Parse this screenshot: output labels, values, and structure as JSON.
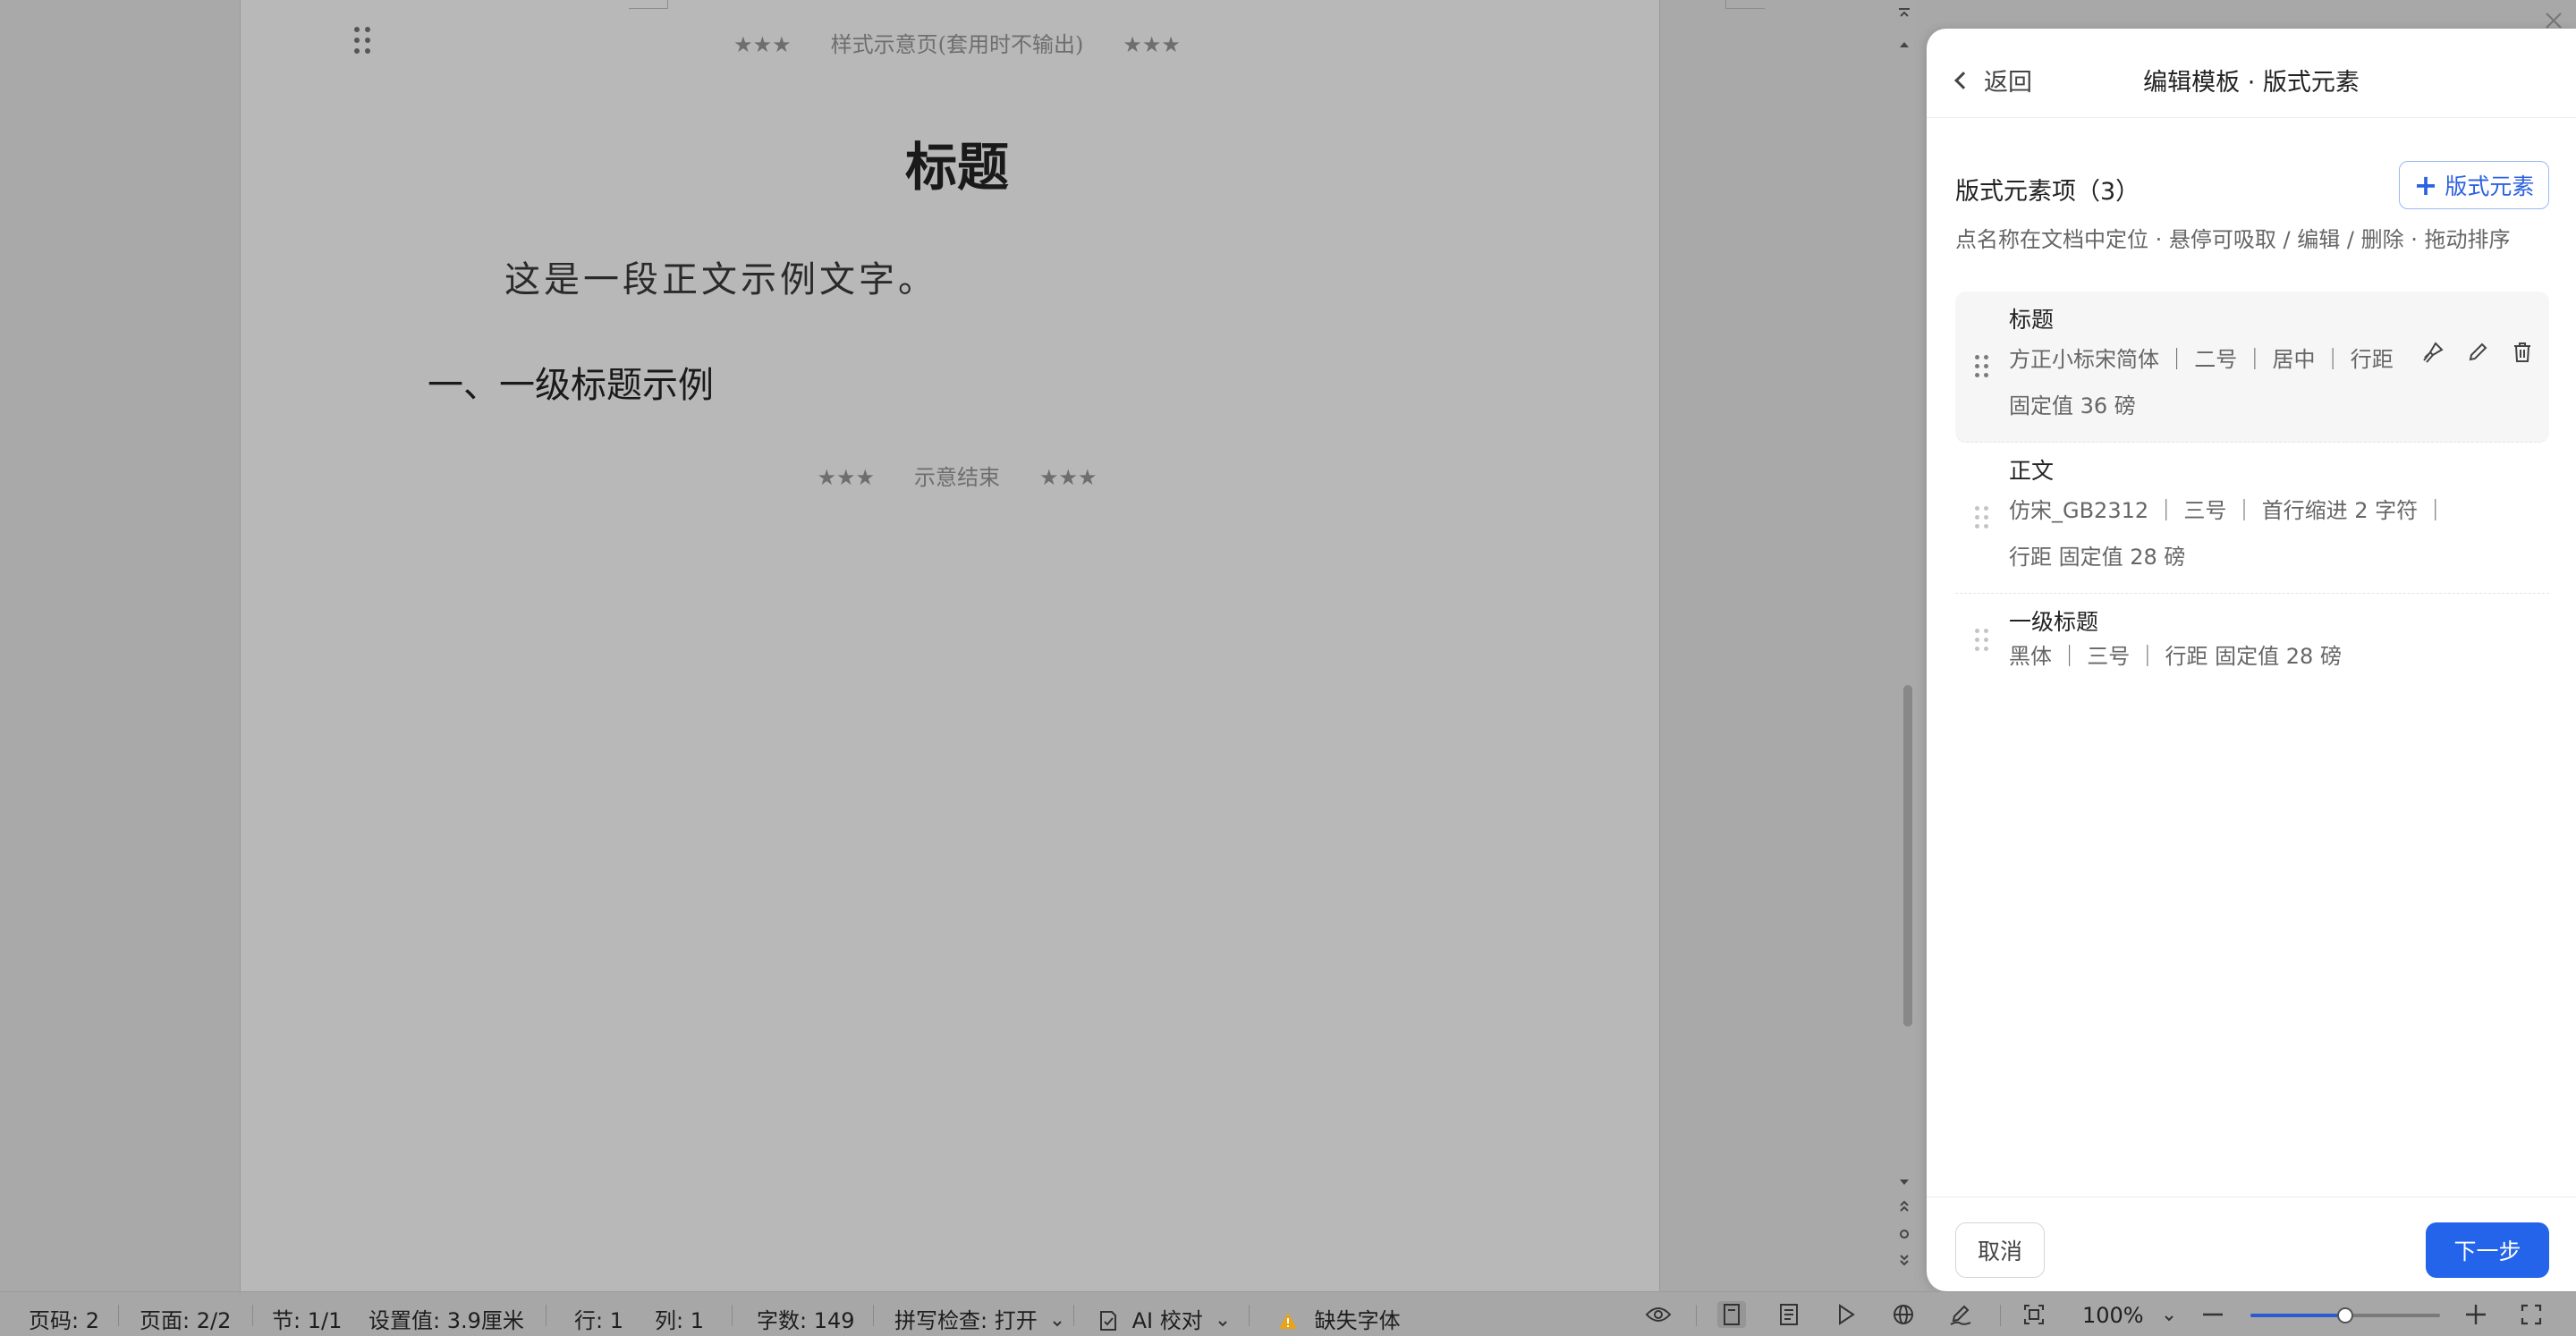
{
  "document": {
    "demo_header": {
      "stars_left": "★★★",
      "text": "样式示意页(套用时不输出)",
      "stars_right": "★★★"
    },
    "title": "标题",
    "body_text": "这是一段正文示例文字。",
    "heading1": "一、一级标题示例",
    "demo_footer": {
      "stars_left": "★★★",
      "text": "示意结束",
      "stars_right": "★★★"
    }
  },
  "panel": {
    "back_label": "返回",
    "title": "编辑模板 · 版式元素",
    "section_title": "版式元素项（3）",
    "add_label": "版式元素",
    "hint": "点名称在文档中定位 · 悬停可吸取 / 编辑 / 删除 · 拖动排序",
    "items": [
      {
        "name": "标题",
        "props": "方正小标宋简体 ｜ 二号 ｜ 居中 ｜ 行距 固定值 36 磅"
      },
      {
        "name": "正文",
        "props": "仿宋_GB2312 ｜ 三号 ｜ 首行缩进 2 字符 ｜ 行距 固定值 28 磅"
      },
      {
        "name": "一级标题",
        "props": "黑体 ｜ 三号 ｜ 行距 固定值 28 磅"
      }
    ],
    "cancel_label": "取消",
    "next_label": "下一步"
  },
  "statusbar": {
    "page_num": "页码: 2",
    "pages": "页面: 2/2",
    "section": "节: 1/1",
    "setting": "设置值: 3.9厘米",
    "row": "行: 1",
    "col": "列: 1",
    "word_count": "字数: 149",
    "spellcheck": "拼写检查: 打开",
    "ai_proof": "AI 校对",
    "missing_font": "缺失字体",
    "zoom": "100%",
    "zoom_level": 0.5
  },
  "colors": {
    "accent": "#2364ea",
    "warning": "#e8a317"
  }
}
